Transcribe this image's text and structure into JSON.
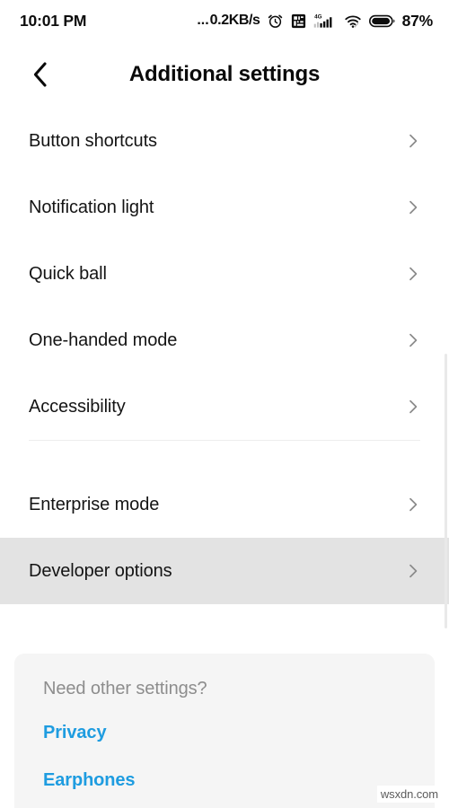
{
  "status_bar": {
    "time": "10:01 PM",
    "network_speed": "0.2KB/s",
    "dots": "...",
    "battery_percent": "87%",
    "signal_label": "4G",
    "icons": [
      "alarm-clock-icon",
      "sd-card-icon",
      "signal-bars-icon",
      "wifi-icon",
      "battery-icon"
    ]
  },
  "header": {
    "title": "Additional settings",
    "back_icon": "chevron-left-icon"
  },
  "list": {
    "groups": [
      {
        "items": [
          {
            "label": "Button shortcuts",
            "pressed": false
          },
          {
            "label": "Notification light",
            "pressed": false
          },
          {
            "label": "Quick ball",
            "pressed": false
          },
          {
            "label": "One-handed mode",
            "pressed": false
          },
          {
            "label": "Accessibility",
            "pressed": false
          }
        ]
      },
      {
        "items": [
          {
            "label": "Enterprise mode",
            "pressed": false
          },
          {
            "label": "Developer options",
            "pressed": true
          }
        ]
      }
    ]
  },
  "footer_card": {
    "heading": "Need other settings?",
    "links": [
      {
        "label": "Privacy"
      },
      {
        "label": "Earphones"
      }
    ]
  },
  "watermark": {
    "text": "wsxdn.com"
  },
  "colors": {
    "accent_link": "#1e9ce0",
    "pressed_row": "#e3e3e3",
    "card_bg": "#f5f5f5",
    "divider": "#ededed",
    "chevron": "#8a8a8a",
    "text_primary": "#141414",
    "text_muted": "#8d8d8d"
  }
}
